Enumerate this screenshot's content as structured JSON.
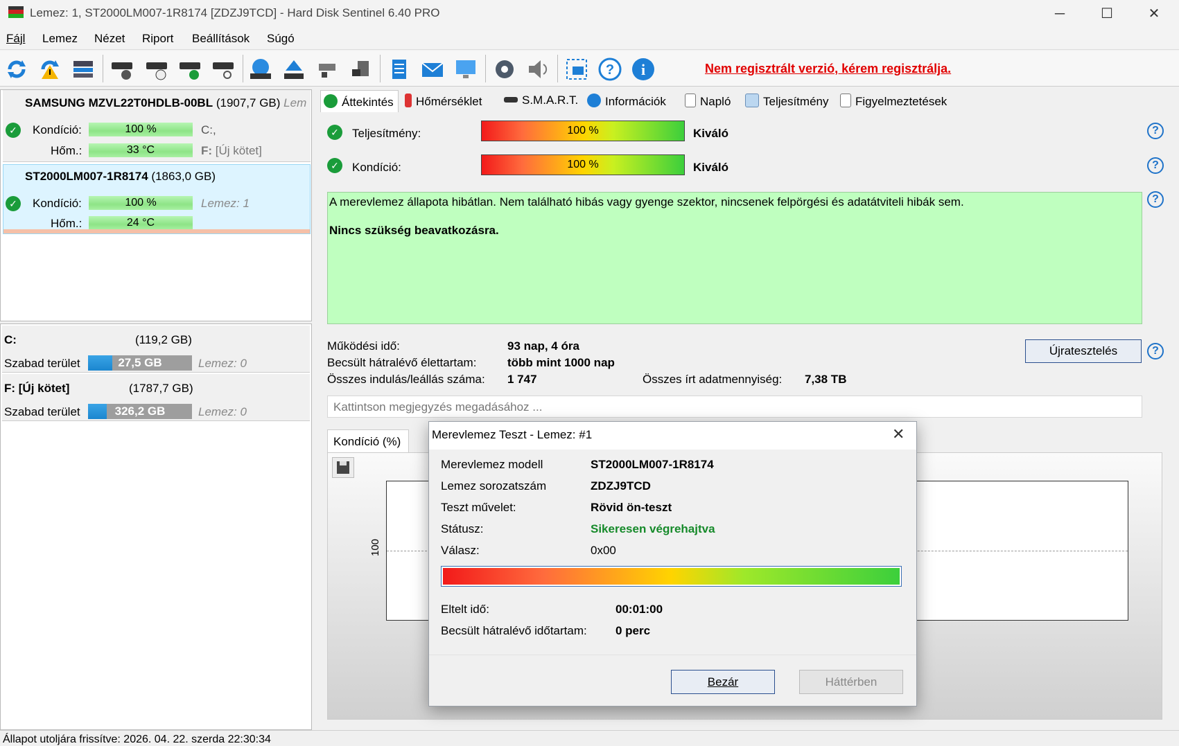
{
  "window": {
    "title": "Lemez: 1, ST2000LM007-1R8174 [ZDZJ9TCD]  -  Hard Disk Sentinel 6.40 PRO",
    "minimize": "─",
    "maximize": "☐",
    "close": "✕"
  },
  "menu": [
    "Fájl",
    "Lemez",
    "Nézet",
    "Riport",
    "Beállítások",
    "Súgó"
  ],
  "toolbar": {
    "icons": [
      "refresh-icon",
      "refresh-warning-icon",
      "disk-list-icon",
      "disk-surface-icon",
      "disk-schedule-icon",
      "disk-ok-icon",
      "disk-search-icon",
      "globe-disk-icon",
      "eject-icon",
      "network-disk-icon",
      "usb-disk-icon",
      "report-icon",
      "email-icon",
      "monitor-icon",
      "settings-icon",
      "sound-icon",
      "screenshot-icon",
      "help-icon",
      "info-icon"
    ],
    "register_text": "Nem regisztrált verzió, kérem regisztrálja."
  },
  "disks": [
    {
      "name": "SAMSUNG MZVL22T0HDLB-00BL",
      "size": "(1907,7 GB)",
      "extra": "Lem",
      "condition_label": "Kondíció:",
      "condition_value": "100 %",
      "temp_label": "Hőm.:",
      "temp_value": "33 °C",
      "partitions": "C:,",
      "volume_prefix": "F:",
      "volume_name": "[Új kötet]"
    },
    {
      "name": "ST2000LM007-1R8174",
      "size": "(1863,0 GB)",
      "condition_label": "Kondíció:",
      "condition_value": "100 %",
      "temp_label": "Hőm.:",
      "temp_value": "24 °C",
      "disk_ref": "Lemez: 1"
    }
  ],
  "volumes": [
    {
      "name": "C:",
      "size": "(119,2 GB)",
      "free_label": "Szabad terület",
      "free_value": "27,5 GB",
      "free_ratio": 0.23,
      "disk_ref": "Lemez: 0"
    },
    {
      "name": "F: [Új kötet]",
      "size": "(1787,7 GB)",
      "free_label": "Szabad terület",
      "free_value": "326,2 GB",
      "free_ratio": 0.18,
      "disk_ref": "Lemez: 0"
    }
  ],
  "tabs": [
    "Áttekintés",
    "Hőmérséklet",
    "S.M.A.R.T.",
    "Információk",
    "Napló",
    "Teljesítmény",
    "Figyelmeztetések"
  ],
  "overview": {
    "performance_label": "Teljesítmény:",
    "performance_value": "100 %",
    "performance_rating": "Kiváló",
    "condition_label": "Kondíció:",
    "condition_value": "100 %",
    "condition_rating": "Kiváló",
    "status_text": "A merevlemez állapota hibátlan. Nem található hibás vagy gyenge szektor, nincsenek felpörgési és adatátviteli hibák sem.",
    "status_action": "Nincs szükség beavatkozásra.",
    "uptime_label": "Működési idő:",
    "uptime_value": "93 nap, 4 óra",
    "lifetime_label": "Becsült hátralévő élettartam:",
    "lifetime_value": "több mint 1000 nap",
    "startstop_label": "Összes indulás/leállás száma:",
    "startstop_value": "1 747",
    "written_label": "Összes írt adatmennyiség:",
    "written_value": "7,38 TB",
    "retest_button": "Újratesztelés",
    "note_placeholder": "Kattintson megjegyzés megadásához ...",
    "chart_tab": "Kondíció   (%)",
    "chart_ytick": "100"
  },
  "dialog": {
    "title": "Merevlemez Teszt - Lemez: #1",
    "model_label": "Merevlemez modell",
    "model_value": "ST2000LM007-1R8174",
    "serial_label": "Lemez sorozatszám",
    "serial_value": "ZDZJ9TCD",
    "op_label": "Teszt művelet:",
    "op_value": "Rövid ön-teszt",
    "status_label": "Státusz:",
    "status_value": "Sikeresen végrehajtva",
    "reply_label": "Válasz:",
    "reply_value": "0x00",
    "progress": 1.0,
    "elapsed_label": "Eltelt idő:",
    "elapsed_value": "00:01:00",
    "remaining_label": "Becsült hátralévő időtartam:",
    "remaining_value": "0 perc",
    "close_button": "Bezár",
    "background_button": "Háttérben"
  },
  "statusbar": {
    "text": "Állapot utoljára frissítve: 2026. 04. 22. szerda 22:30:34"
  },
  "colors": {
    "ok_green": "#1a9c3a",
    "status_bg": "#bfffbf",
    "warning_red": "#e10000",
    "help_blue": "#1f73c9"
  }
}
